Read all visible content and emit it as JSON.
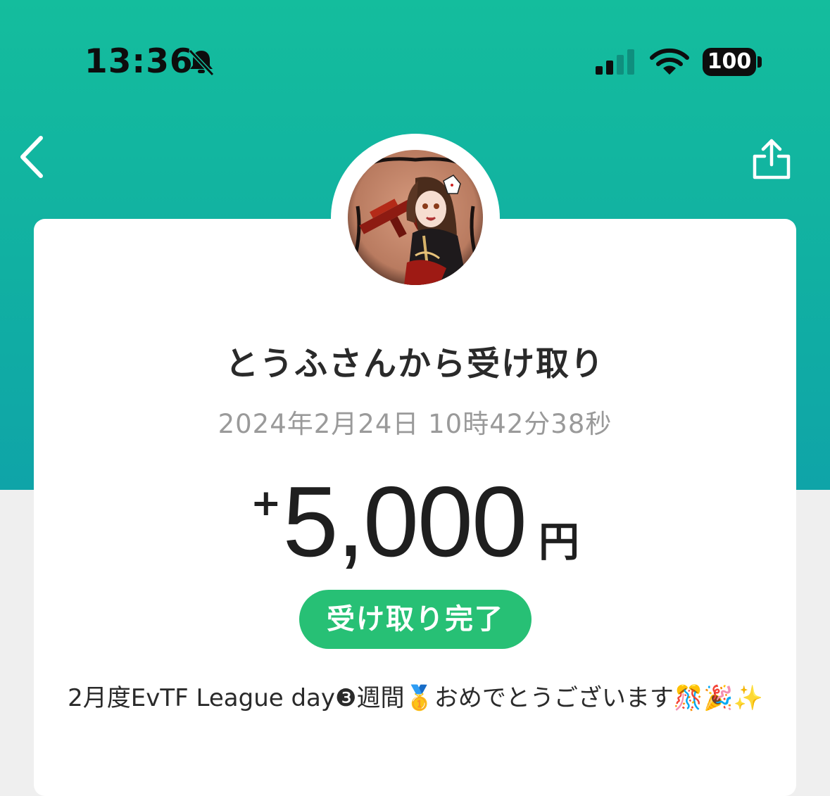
{
  "status_bar": {
    "time": "13:36",
    "battery": "100",
    "icons": [
      "bell-slash-icon",
      "cellular-signal-icon",
      "wifi-icon",
      "battery-icon"
    ]
  },
  "nav": {
    "back_icon": "chevron-left-icon",
    "share_icon": "share-icon"
  },
  "colors": {
    "header_gradient_top": "#14bd9d",
    "header_gradient_bottom": "#0fa4a8",
    "status_pill": "#27c075",
    "date_text": "#9a9a9a",
    "page_background": "#efefef"
  },
  "transaction": {
    "title": "とうふさんから受け取り",
    "datetime": "2024年2月24日 10時42分38秒",
    "amount_sign": "+",
    "amount": "5,000",
    "currency": "円",
    "status": "受け取り完了",
    "message": "2月度EvTF League day❸週間🥇おめでとうございます🎊🎉✨"
  }
}
